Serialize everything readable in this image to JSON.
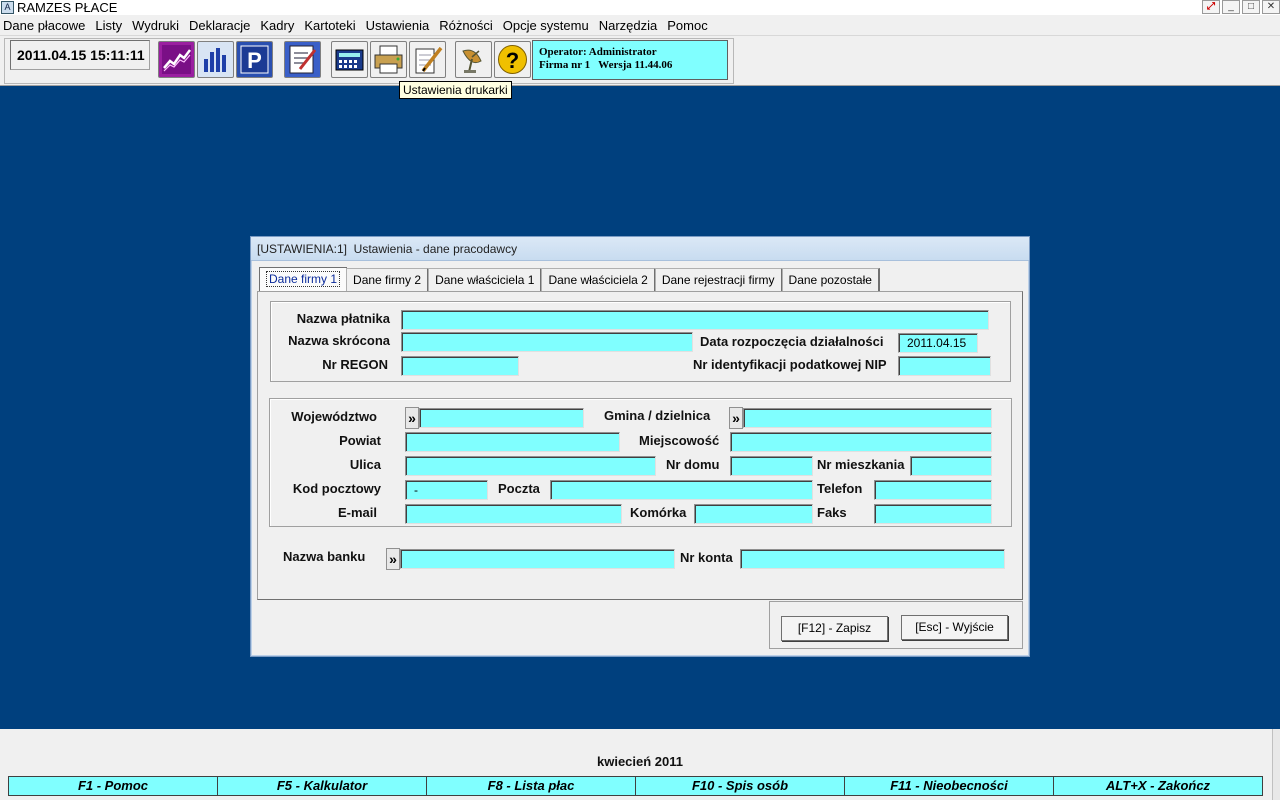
{
  "window": {
    "title": "RAMZES PŁACE",
    "buttons": [
      "",
      "_",
      "□",
      "✕"
    ]
  },
  "menu": [
    "Dane płacowe",
    "Listy",
    "Wydruki",
    "Deklaracje",
    "Kadry",
    "Kartoteki",
    "Ustawienia",
    "Różności",
    "Opcje systemu",
    "Narzędzia",
    "Pomoc"
  ],
  "toolbar": {
    "datetime": "2011.04.15 15:11:11",
    "operator_line": "Operator: Administrator",
    "company_line": "Firma nr 1   Wersja 11.44.06",
    "tooltip": "Ustawienia drukarki",
    "icons": [
      "chart-line-icon",
      "bar-chart-icon",
      "p-letter-icon",
      "edit-document-icon",
      "calculator-icon",
      "printer-icon",
      "notebook-icon",
      "satellite-dish-icon",
      "help-icon"
    ]
  },
  "dialog": {
    "title": "[USTAWIENIA:1]  Ustawienia - dane pracodawcy",
    "tabs": [
      "Dane firmy 1",
      "Dane firmy 2",
      "Dane właściciela 1",
      "Dane właściciela 2",
      "Dane rejestracji firmy",
      "Dane pozostałe"
    ],
    "active_tab": "Dane firmy 1",
    "labels": {
      "nazwa_platnika": "Nazwa płatnika",
      "nazwa_skrocona": "Nazwa skrócona",
      "data_rozpoczecia": "Data rozpoczęcia działalności",
      "nr_regon": "Nr REGON",
      "nip": "Nr identyfikacji podatkowej NIP",
      "wojewodztwo": "Województwo",
      "gmina": "Gmina / dzielnica",
      "powiat": "Powiat",
      "miejscowosc": "Miejscowość",
      "ulica": "Ulica",
      "nr_domu": "Nr domu",
      "nr_mieszkania": "Nr mieszkania",
      "kod_pocztowy": "Kod pocztowy",
      "poczta": "Poczta",
      "telefon": "Telefon",
      "email": "E-mail",
      "komorka": "Komórka",
      "faks": "Faks",
      "nazwa_banku": "Nazwa banku",
      "nr_konta": "Nr konta"
    },
    "values": {
      "data_rozpoczecia": "2011.04.15",
      "kod_pocztowy": "-"
    },
    "selector_glyph": "»",
    "buttons": {
      "save": "[F12] - Zapisz",
      "exit": "[Esc] - Wyjście"
    }
  },
  "footer": {
    "month": "kwiecień 2011",
    "fkeys": [
      "F1 - Pomoc",
      "F5 - Kalkulator",
      "F8 - Lista płac",
      "F10 - Spis osób",
      "F11 - Nieobecności",
      "ALT+X - Zakończ"
    ]
  }
}
